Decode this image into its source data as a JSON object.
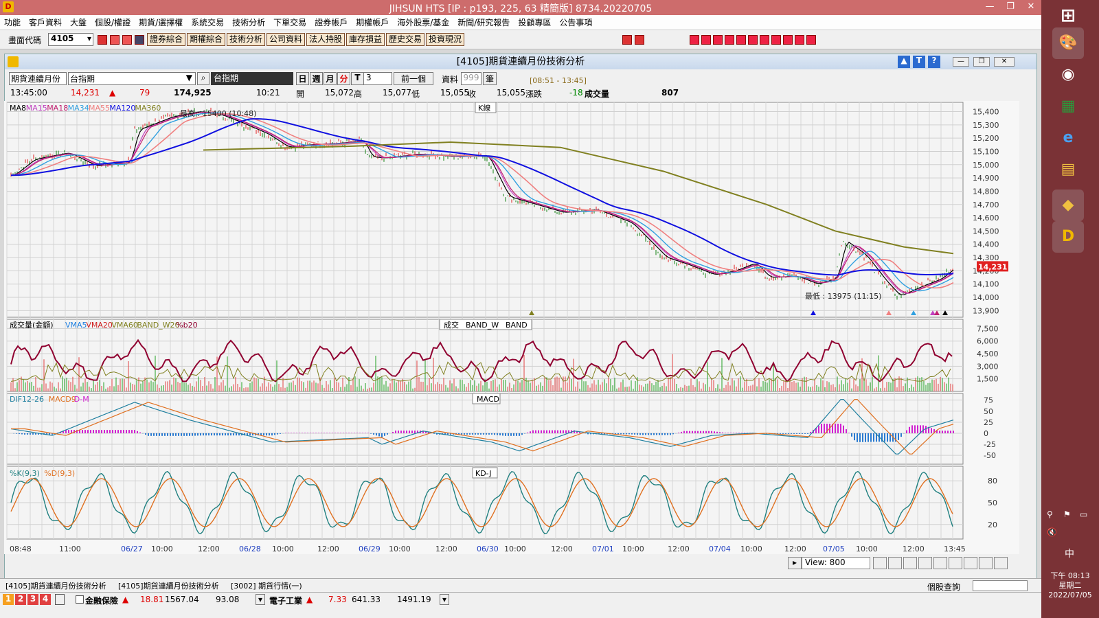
{
  "title": "JIHSUN HTS      [IP : p193, 225, 63 精簡版] 8734.20220705",
  "menu": [
    "功能",
    "客戶資料",
    "大盤",
    "個股/權證",
    "期貨/選擇權",
    "系統交易",
    "技術分析",
    "下單交易",
    "證券帳戶",
    "期權帳戶",
    "海外股票/基金",
    "新聞/研究報告",
    "投顧專區",
    "公告事項"
  ],
  "toolbar": {
    "code_label": "畫面代碼",
    "code_value": "4105",
    "buttons": [
      "證券綜合",
      "期權綜合",
      "技術分析",
      "公司資料",
      "法人持股",
      "庫存損益",
      "歷史交易",
      "投資現況"
    ]
  },
  "window": {
    "title": "[4105]期貨連續月份技術分析"
  },
  "controls": {
    "type": "期貨連續月份",
    "symbol": "台指期",
    "symbol_name": "台指期",
    "periods": [
      "日",
      "週",
      "月",
      "分",
      "T"
    ],
    "period_value": "3",
    "prev": "前一個",
    "data_label": "資料",
    "data_value": "999",
    "unit": "筆",
    "time_range": "[08:51 - 13:45]"
  },
  "quote": {
    "time": "13:45:00",
    "price": "14,231",
    "change": "79",
    "volume_total": "174,925",
    "bar_time": "10:21",
    "open_label": "開",
    "open": "15,072",
    "high_label": "高",
    "high": "15,077",
    "low_label": "低",
    "low": "15,055",
    "close_label": "收",
    "close": "15,055",
    "chg_label": "漲跌",
    "chg": "-18",
    "vol_label": "成交量",
    "vol": "807"
  },
  "panels": {
    "k": {
      "title": "K線",
      "legend": [
        "MA8",
        "MA15",
        "MA18",
        "MA34",
        "MA55",
        "MA120",
        "MA360"
      ],
      "legend_colors": [
        "#000",
        "#c040c0",
        "#c02070",
        "#30a0e0",
        "#f08080",
        "#1010e0",
        "#808020"
      ],
      "high_note": "最高 : 15400 (10:48)",
      "low_note": "最低 : 13975 (11:15)",
      "last_price": "14,231",
      "ticks": [
        "15,400",
        "15,300",
        "15,200",
        "15,100",
        "15,000",
        "14,900",
        "14,800",
        "14,700",
        "14,600",
        "14,500",
        "14,400",
        "14,300",
        "14,200",
        "14,100",
        "14,000",
        "13,900"
      ]
    },
    "vol": {
      "title_parts": [
        "成交",
        "BAND_W",
        "BAND"
      ],
      "legend": [
        "成交量(金額)",
        "VMA5",
        "VMA20",
        "VMA60",
        "BAND_W20",
        "%b20"
      ],
      "legend_colors": [
        "#000",
        "#2080e0",
        "#d02020",
        "#808020",
        "#808020",
        "#900030"
      ],
      "ticks": [
        "7,500",
        "6,000",
        "4,500",
        "3,000",
        "1,500"
      ]
    },
    "macd": {
      "title": "MACD",
      "legend": [
        "DIF12-26",
        "MACD9",
        "D-M"
      ],
      "legend_colors": [
        "#2080a0",
        "#e07020",
        "#d020d0"
      ],
      "ticks": [
        "75",
        "50",
        "25",
        "0",
        "-25",
        "-50"
      ]
    },
    "kd": {
      "title": "KD-J",
      "legend": [
        "%K(9,3)",
        "%D(9,3)"
      ],
      "legend_colors": [
        "#208080",
        "#e07020"
      ],
      "ticks": [
        "80",
        "50",
        "20"
      ]
    }
  },
  "xaxis": [
    "08:48",
    "11:00",
    "06/27",
    "10:00",
    "12:00",
    "06/28",
    "10:00",
    "12:00",
    "06/29",
    "10:00",
    "12:00",
    "06/30",
    "10:00",
    "12:00",
    "07/01",
    "10:00",
    "12:00",
    "07/04",
    "10:00",
    "12:00",
    "07/05",
    "10:00",
    "12:00",
    "13:45"
  ],
  "view": "View:  800",
  "tabs": [
    "[4105]期貨連續月份技術分析",
    "[4105]期貨連續月份技術分析",
    "[3002] 期貨行情(一)"
  ],
  "search_label": "個股查詢",
  "status": {
    "nums": [
      "1",
      "2",
      "3",
      "4"
    ],
    "name1": "金融保險",
    "v1a": "18.81",
    "v1b": "1567.04",
    "v1c": "93.08",
    "name2": "電子工業",
    "v2a": "7.33",
    "v2b": "641.33",
    "v2c": "1491.19"
  },
  "clock": {
    "time": "下午 08:13",
    "day": "星期二",
    "date": "2022/07/05",
    "ime": "中"
  }
}
